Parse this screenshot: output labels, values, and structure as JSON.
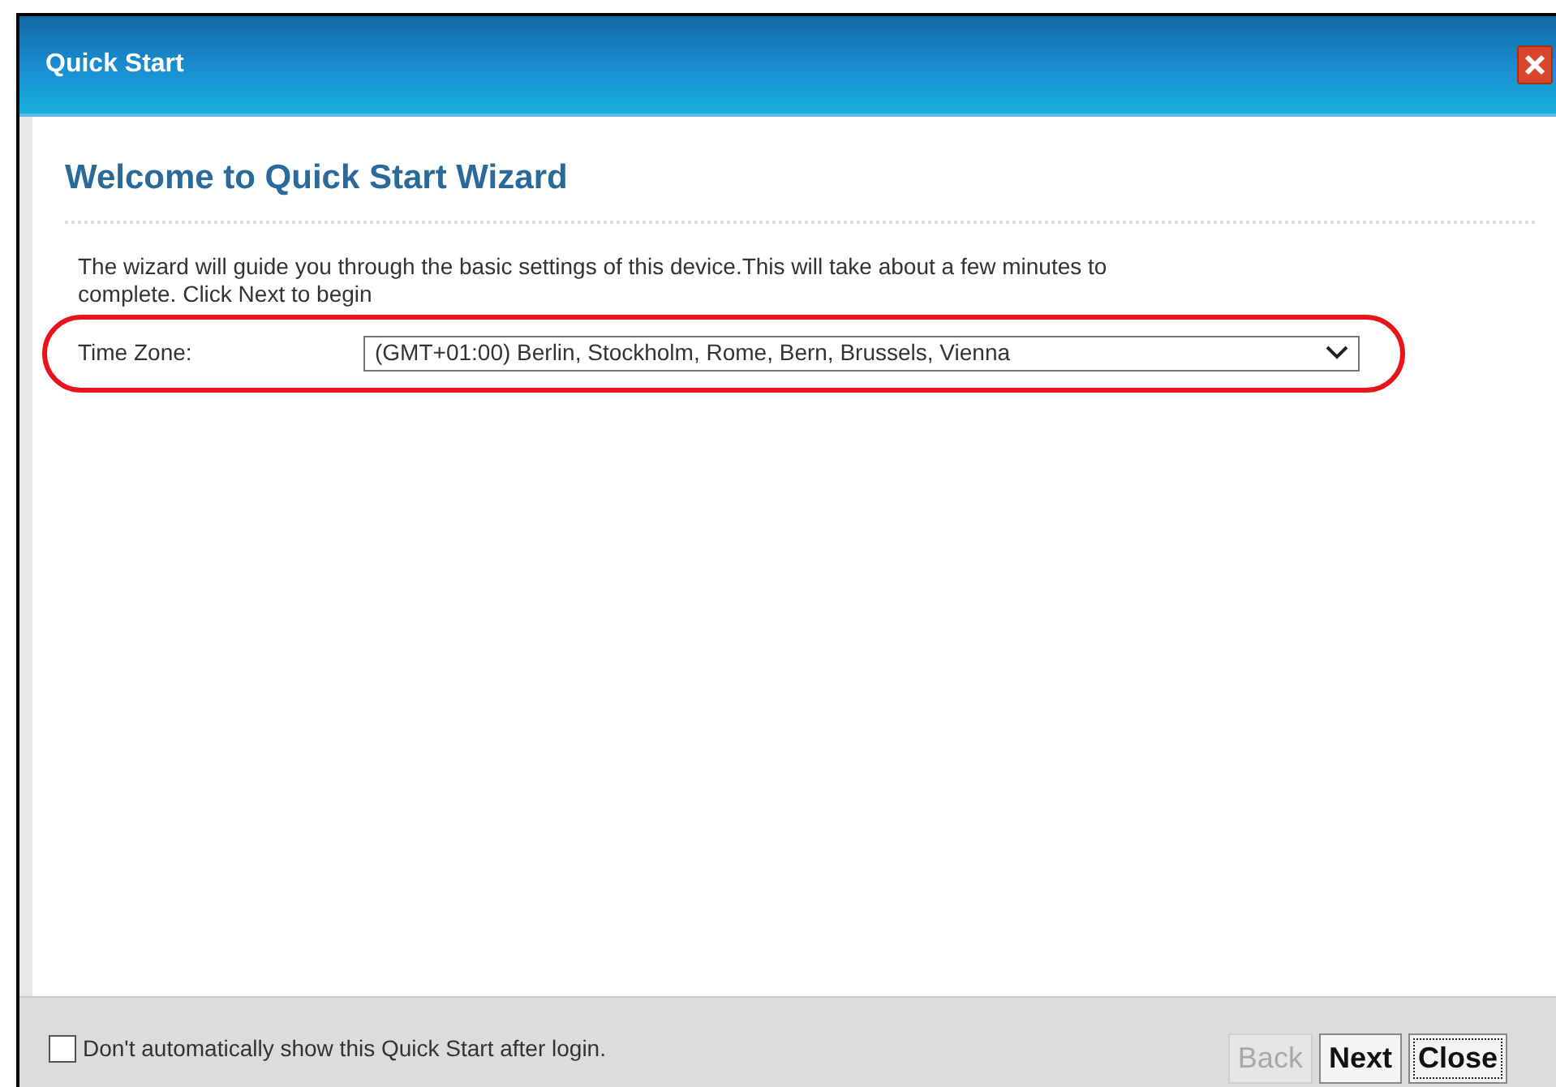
{
  "window": {
    "title": "Quick Start"
  },
  "heading": "Welcome to Quick Start Wizard",
  "intro": "The wizard will guide you through the basic settings of this device.This will take about a few minutes to complete. Click Next to begin",
  "time_zone": {
    "label": "Time Zone:",
    "value": "(GMT+01:00) Berlin, Stockholm, Rome, Bern, Brussels, Vienna"
  },
  "footer": {
    "checkbox": {
      "label": "Don't automatically show this Quick Start after login.",
      "checked": false
    },
    "buttons": [
      {
        "label": "Back",
        "disabled": true,
        "focused": false
      },
      {
        "label": "Next",
        "disabled": false,
        "focused": false
      },
      {
        "label": "Close",
        "disabled": false,
        "focused": true
      }
    ]
  }
}
